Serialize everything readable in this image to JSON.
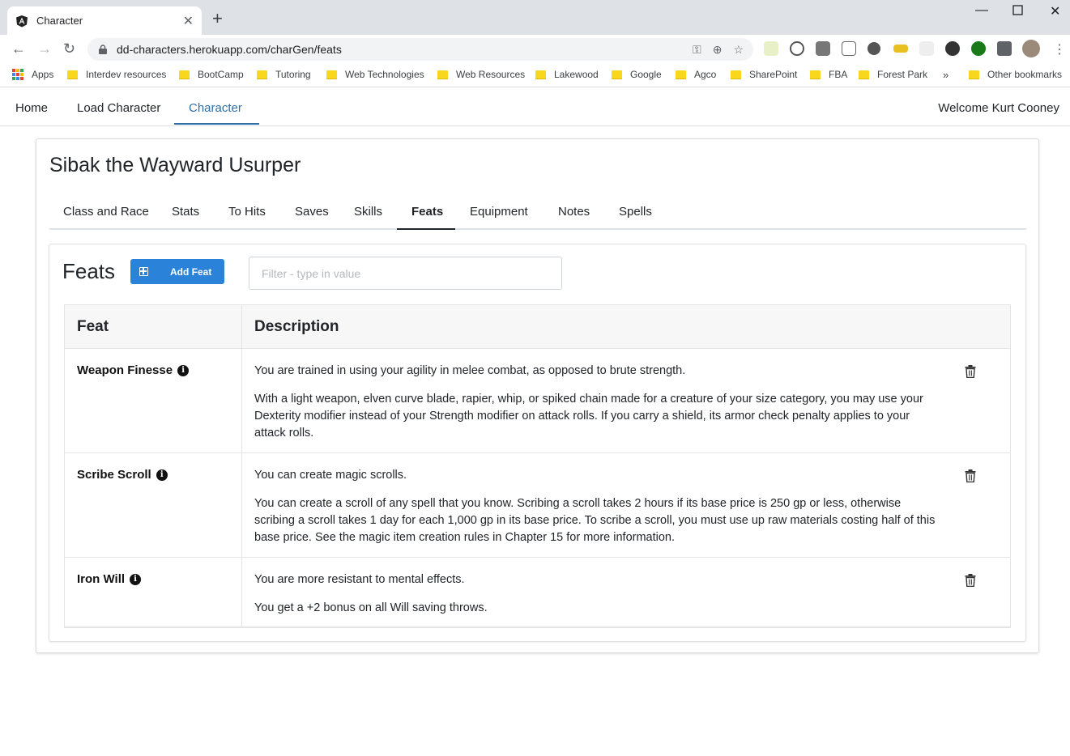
{
  "browser": {
    "tab_title": "Character",
    "url": "dd-characters.herokuapp.com/charGen/feats",
    "bookmarks": [
      {
        "label": "Apps"
      },
      {
        "label": "Interdev resources"
      },
      {
        "label": "BootCamp"
      },
      {
        "label": "Tutoring"
      },
      {
        "label": "Web Technologies"
      },
      {
        "label": "Web Resources"
      },
      {
        "label": "Lakewood"
      },
      {
        "label": "Google"
      },
      {
        "label": "Agco"
      },
      {
        "label": "SharePoint"
      },
      {
        "label": "FBA"
      },
      {
        "label": "Forest Park"
      },
      {
        "label": "»"
      },
      {
        "label": "Other bookmarks"
      }
    ]
  },
  "nav": {
    "home": "Home",
    "load_character": "Load Character",
    "character": "Character",
    "welcome": "Welcome Kurt Cooney"
  },
  "character": {
    "name": "Sibak the Wayward Usurper",
    "tabs": [
      {
        "label": "Class and Race"
      },
      {
        "label": "Stats"
      },
      {
        "label": "To Hits"
      },
      {
        "label": "Saves"
      },
      {
        "label": "Skills"
      },
      {
        "label": "Feats"
      },
      {
        "label": "Equipment"
      },
      {
        "label": "Notes"
      },
      {
        "label": "Spells"
      }
    ],
    "active_tab": "Feats"
  },
  "feats": {
    "title": "Feats",
    "add_button": "Add Feat",
    "filter_placeholder": "Filter - type in value",
    "columns": [
      "Feat",
      "Description"
    ],
    "rows": [
      {
        "name": "Weapon Finesse",
        "summary": "You are trained in using your agility in melee combat, as opposed to brute strength.",
        "detail": "With a light weapon, elven curve blade, rapier, whip, or spiked chain made for a creature of your size category, you may use your Dexterity modifier instead of your Strength modifier on attack rolls. If you carry a shield, its armor check penalty applies to your attack rolls."
      },
      {
        "name": "Scribe Scroll",
        "summary": "You can create magic scrolls.",
        "detail": "You can create a scroll of any spell that you know. Scribing a scroll takes 2 hours if its base price is 250 gp or less, otherwise scribing a scroll takes 1 day for each 1,000 gp in its base price. To scribe a scroll, you must use up raw materials costing half of this base price. See the magic item creation rules in Chapter 15 for more information."
      },
      {
        "name": "Iron Will",
        "summary": "You are more resistant to mental effects.",
        "detail": "You get a +2 bonus on all Will saving throws."
      }
    ]
  },
  "colors": {
    "accent": "#2f6fa7",
    "button": "#2a83d9"
  }
}
